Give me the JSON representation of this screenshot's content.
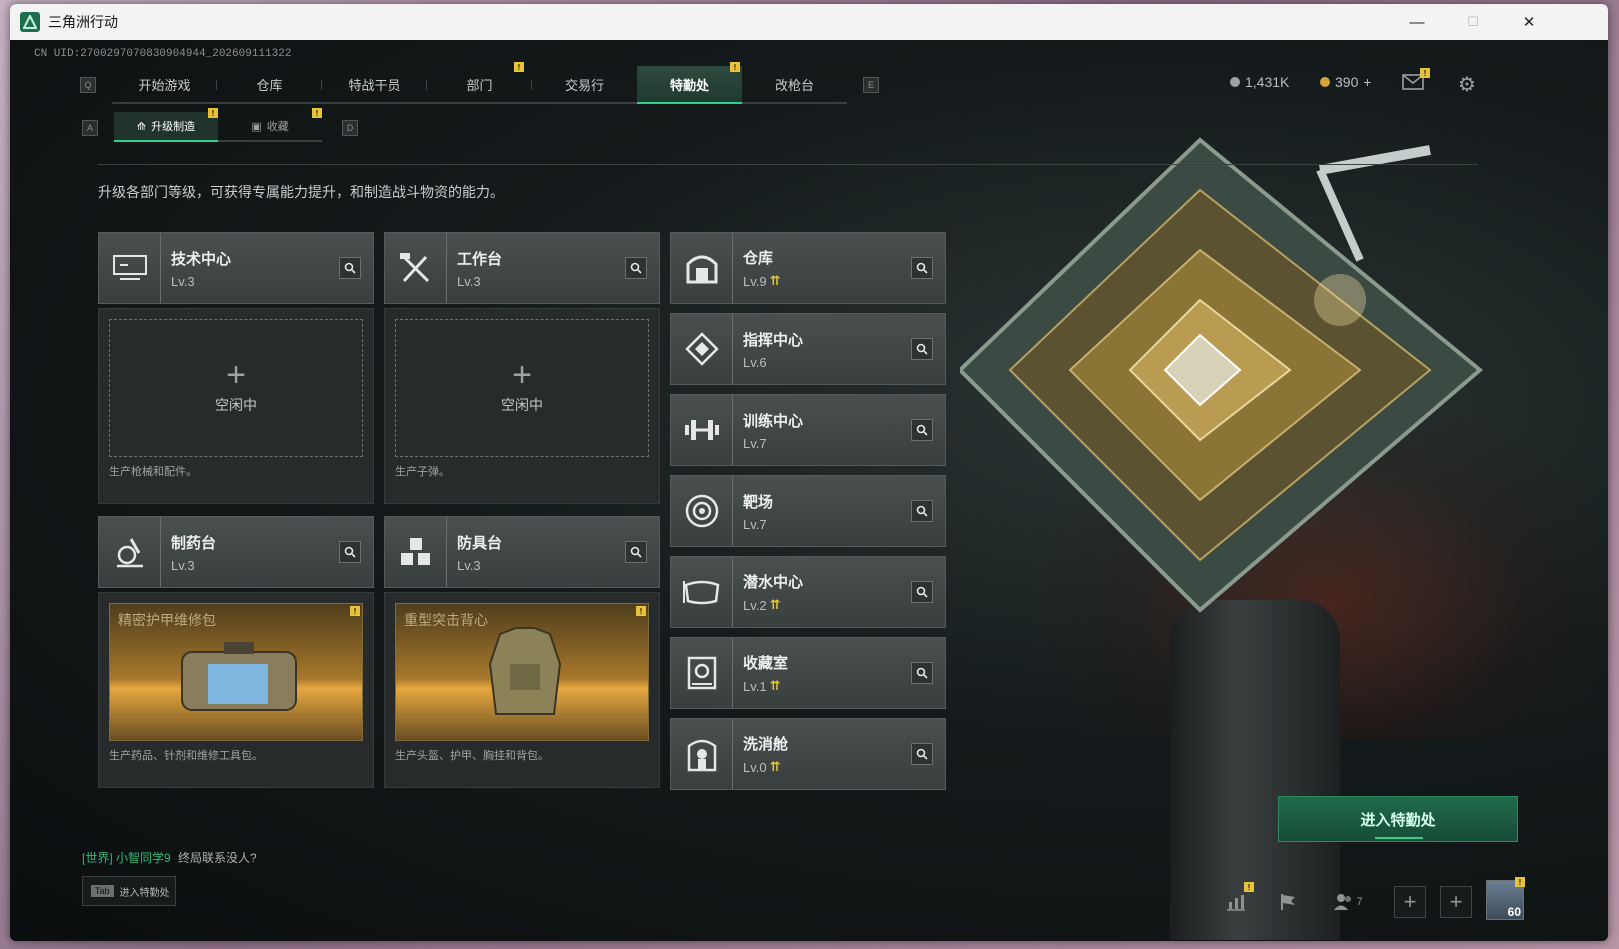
{
  "window": {
    "title": "三角洲行动",
    "minimize": "—",
    "maximize": "☐",
    "close": "✕"
  },
  "uid": "CN UID:2700297070830904944_202609111322",
  "keys": {
    "left_tab": "Q",
    "right_tab": "E",
    "sub_left": "A",
    "sub_right": "D"
  },
  "nav": {
    "tabs": [
      {
        "label": "开始游戏"
      },
      {
        "label": "仓库"
      },
      {
        "label": "特战干员"
      },
      {
        "label": "部门"
      },
      {
        "label": "交易行"
      },
      {
        "label": "特勤处"
      },
      {
        "label": "改枪台"
      }
    ],
    "active": "特勤处"
  },
  "currency": {
    "silver": "1,431K",
    "gold": "390",
    "gold_add": "+"
  },
  "subnav": {
    "tabs": [
      {
        "label": "升级制造"
      },
      {
        "label": "收藏"
      }
    ]
  },
  "intro": "升级各部门等级，可获得专属能力提升，和制造战斗物资的能力。",
  "production": [
    {
      "name": "技术中心",
      "level": "Lv.3",
      "slot": "空闲中",
      "desc": "生产枪械和配件。"
    },
    {
      "name": "工作台",
      "level": "Lv.3",
      "slot": "空闲中",
      "desc": "生产子弹。"
    },
    {
      "name": "制药台",
      "level": "Lv.3",
      "item": "精密护甲维修包",
      "desc": "生产药品、针剂和维修工具包。"
    },
    {
      "name": "防具台",
      "level": "Lv.3",
      "item": "重型突击背心",
      "desc": "生产头盔、护甲、胸挂和背包。"
    }
  ],
  "facilities": [
    {
      "name": "仓库",
      "level": "Lv.9",
      "upgrade": true
    },
    {
      "name": "指挥中心",
      "level": "Lv.6",
      "upgrade": false
    },
    {
      "name": "训练中心",
      "level": "Lv.7",
      "upgrade": false
    },
    {
      "name": "靶场",
      "level": "Lv.7",
      "upgrade": false
    },
    {
      "name": "潜水中心",
      "level": "Lv.2",
      "upgrade": true
    },
    {
      "name": "收藏室",
      "level": "Lv.1",
      "upgrade": true
    },
    {
      "name": "洗消舱",
      "level": "Lv.0",
      "upgrade": true
    }
  ],
  "notif_mark": "!",
  "enter_button": "进入特勤处",
  "chat": {
    "channel": "[世界]",
    "user": "小智同学9",
    "message": "终局联系没人?"
  },
  "tab_hint": {
    "key": "Tab",
    "label": "进入特勤处"
  },
  "bottom": {
    "friends_count": "7",
    "avatar_level": "60"
  },
  "colors": {
    "accent": "#2fd28a",
    "notice": "#e8c23a",
    "upgrade": "#e8c23a"
  }
}
